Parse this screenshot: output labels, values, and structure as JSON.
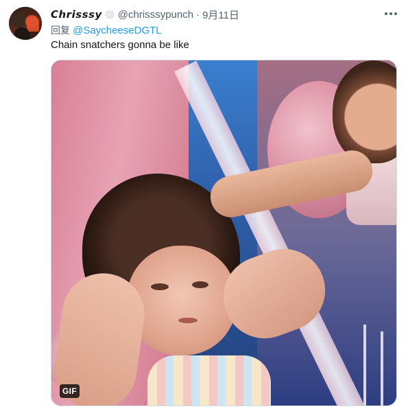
{
  "tweet": {
    "display_name": "𝘾𝙝𝙧𝙞𝙨𝙨𝙨𝙮",
    "badge_icon": "sparkle-circle-icon",
    "handle": "@chrisssypunch",
    "separator": "·",
    "date": "9月11日",
    "more_icon": "more-horizontal-icon",
    "reply_prefix": "回复",
    "reply_to": "@SaycheeseDGTL",
    "text": "Chain snatchers gonna be like",
    "media": {
      "badge": "GIF"
    }
  },
  "colors": {
    "link": "#1d9bf0",
    "secondary_text": "#536471",
    "primary_text": "#0f1419",
    "border": "#cfd9de"
  }
}
